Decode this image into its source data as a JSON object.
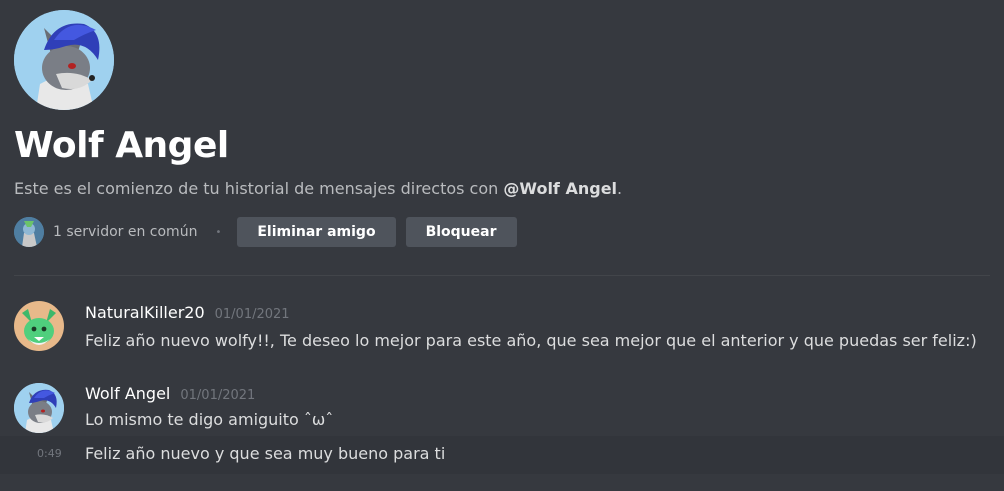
{
  "profile": {
    "name": "Wolf Angel",
    "description_prefix": "Este es el comienzo de tu historial de mensajes directos con ",
    "description_mention": "@Wolf Angel",
    "description_suffix": ".",
    "mutual_servers": "1 servidor en común",
    "separator": "•",
    "remove_friend_label": "Eliminar amigo",
    "block_label": "Bloquear"
  },
  "messages": [
    {
      "author": "NaturalKiller20",
      "timestamp": "01/01/2021",
      "text": "Feliz año nuevo wolfy!!, Te deseo lo mejor para este año, que sea mejor que el anterior y que puedas ser feliz:)"
    },
    {
      "author": "Wolf Angel",
      "timestamp": "01/01/2021",
      "text": "Lo mismo te digo amiguito ˆωˆ",
      "followup_time": "0:49",
      "followup_text": "Feliz año nuevo y que sea muy bueno para ti"
    }
  ],
  "colors": {
    "background": "#36393f",
    "button": "#4f545c",
    "accent_avatar_bg": "#9fd1ef"
  },
  "icons": {
    "profile_avatar": "wolf-avatar-icon",
    "mutual_server": "server-icon",
    "natural_killer_avatar": "green-creature-avatar-icon"
  }
}
